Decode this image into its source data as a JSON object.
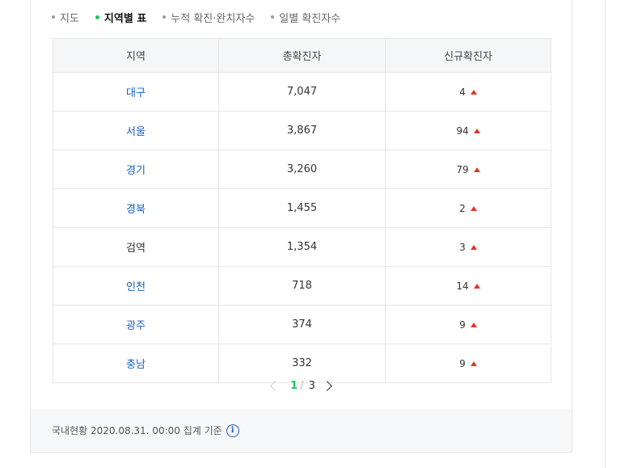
{
  "tabs": [
    {
      "label": "지도",
      "active": false
    },
    {
      "label": "지역별 표",
      "active": true
    },
    {
      "label": "누적 확진·완치자수",
      "active": false
    },
    {
      "label": "일별 확진자수",
      "active": false
    }
  ],
  "table": {
    "headers": [
      "지역",
      "총확진자",
      "신규확진자"
    ],
    "rows": [
      {
        "region": "대구",
        "total": "7,047",
        "new": "4",
        "link": true
      },
      {
        "region": "서울",
        "total": "3,867",
        "new": "94",
        "link": true
      },
      {
        "region": "경기",
        "total": "3,260",
        "new": "79",
        "link": true
      },
      {
        "region": "경북",
        "total": "1,455",
        "new": "2",
        "link": true
      },
      {
        "region": "검역",
        "total": "1,354",
        "new": "3",
        "link": false
      },
      {
        "region": "인천",
        "total": "718",
        "new": "14",
        "link": true
      },
      {
        "region": "광주",
        "total": "374",
        "new": "9",
        "link": true
      },
      {
        "region": "충남",
        "total": "332",
        "new": "9",
        "link": true
      }
    ]
  },
  "pagination": {
    "current": "1",
    "separator": "/",
    "total": "3"
  },
  "footer": {
    "text": "국내현황 2020.08.31. 00:00 집계 기준",
    "icon": "info-icon"
  },
  "colors": {
    "accent_green": "#1dc65a",
    "link_blue": "#1a5fc6",
    "increase_red": "#e6332a"
  }
}
